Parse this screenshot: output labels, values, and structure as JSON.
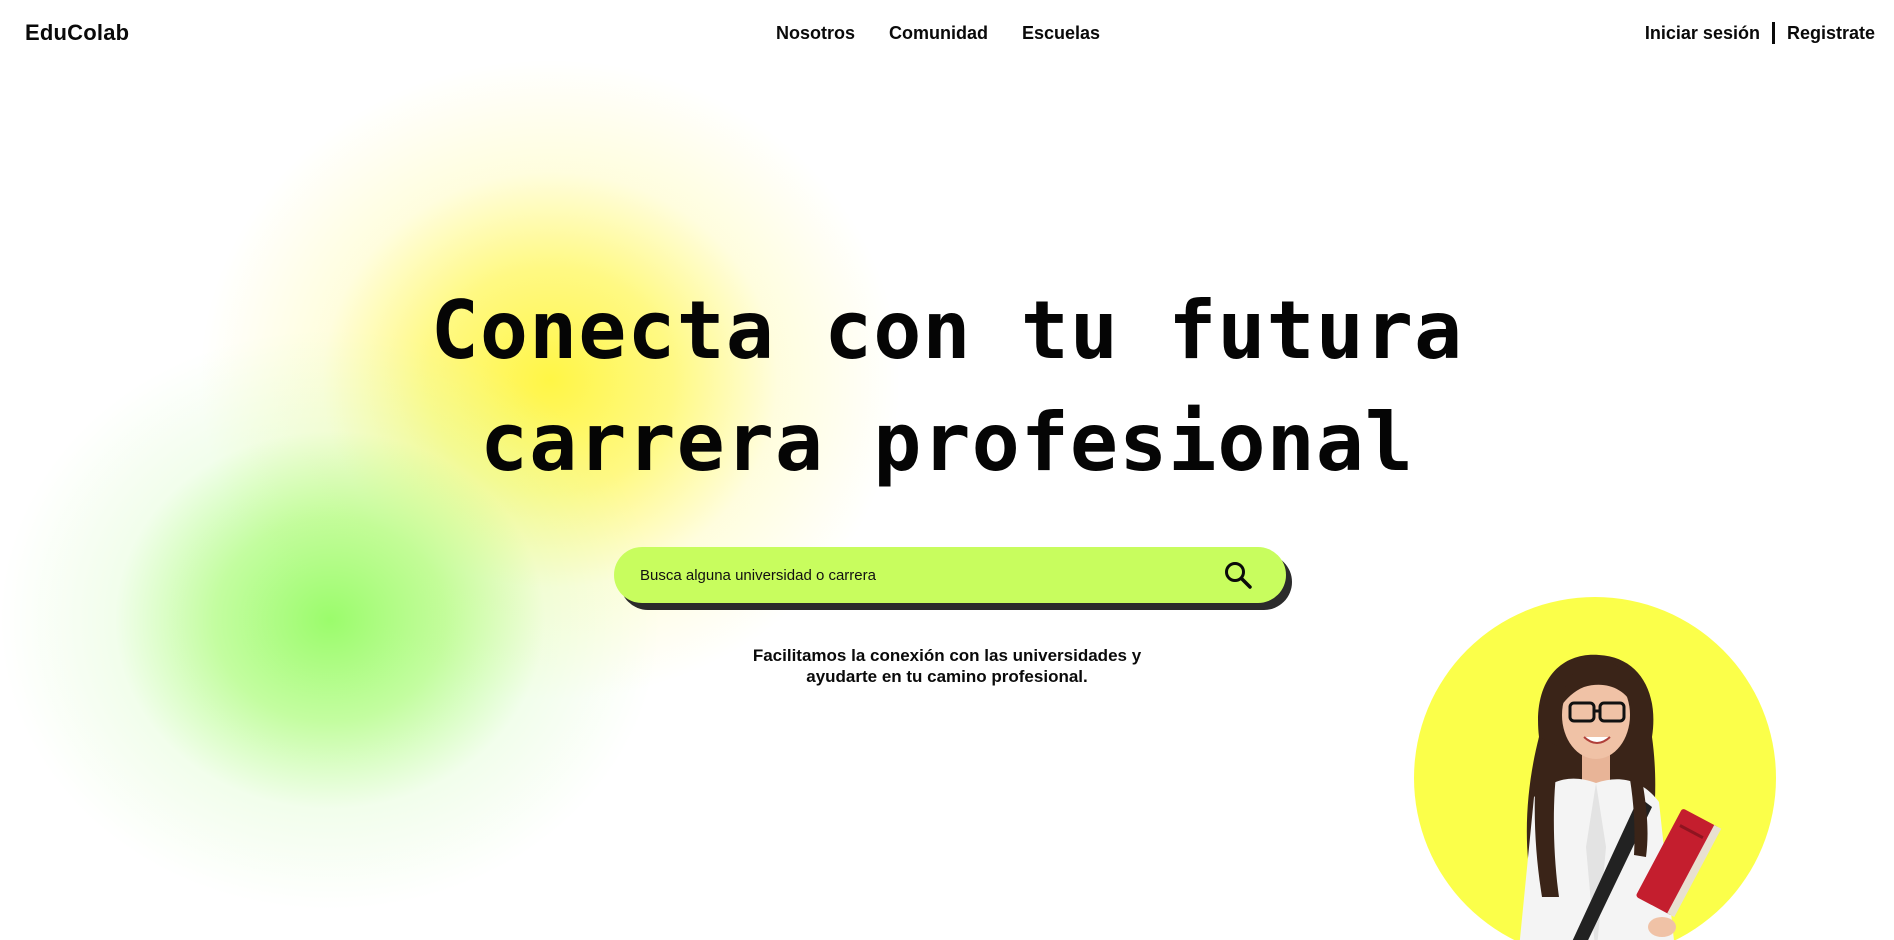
{
  "brand": {
    "name": "EduColab"
  },
  "nav": {
    "links": [
      {
        "label": "Nosotros"
      },
      {
        "label": "Comunidad"
      },
      {
        "label": "Escuelas"
      }
    ]
  },
  "auth": {
    "login_label": "Iniciar sesión",
    "register_label": "Registrate"
  },
  "hero": {
    "title_line1": "Conecta con tu futura",
    "title_line2": "carrera profesional"
  },
  "search": {
    "placeholder": "Busca alguna universidad o carrera",
    "value": "",
    "icon": "search-icon"
  },
  "subtitle": {
    "line1": "Facilitamos la conexión con las universidades y",
    "line2": "ayudarte en tu camino profesional."
  },
  "colors": {
    "search_bar": "#c8fd5e",
    "student_circle": "#fbff4a",
    "blob_yellow": "#fff53c",
    "blob_green": "#96fc64",
    "text": "#0a0a0a"
  }
}
